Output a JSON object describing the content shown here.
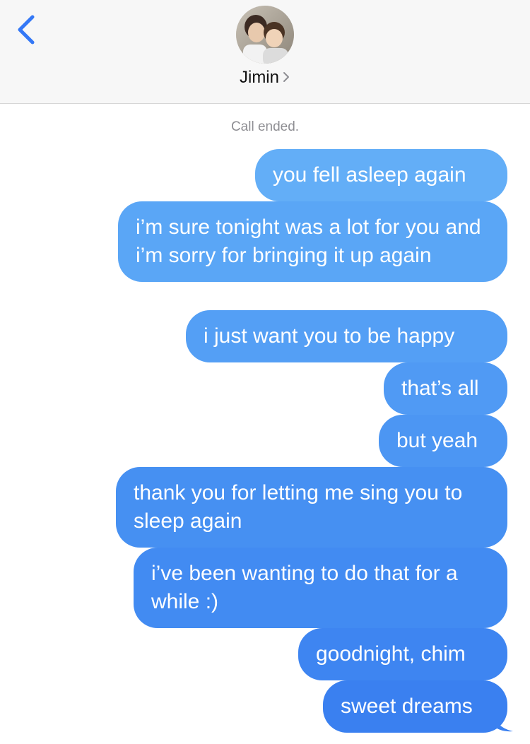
{
  "header": {
    "back_icon": "chevron-left-icon",
    "contact_name": "Jimin",
    "contact_chevron_icon": "chevron-right-icon",
    "accent_color": "#3478f6"
  },
  "thread": {
    "system_message": "Call ended.",
    "messages": [
      {
        "text": "you fell asleep again"
      },
      {
        "text": "i’m sure tonight was a lot for you and i’m sorry for bringing it up again"
      },
      {
        "text": "i just want you to be happy"
      },
      {
        "text": "that’s all"
      },
      {
        "text": "but yeah"
      },
      {
        "text": "thank you for letting me sing you to sleep again"
      },
      {
        "text": "i’ve been wanting to do that for a while :)"
      },
      {
        "text": "goodnight, chim"
      },
      {
        "text": "sweet dreams"
      }
    ],
    "bubble_gradient_top": "#62aef7",
    "bubble_gradient_bottom": "#3a7ef0"
  }
}
